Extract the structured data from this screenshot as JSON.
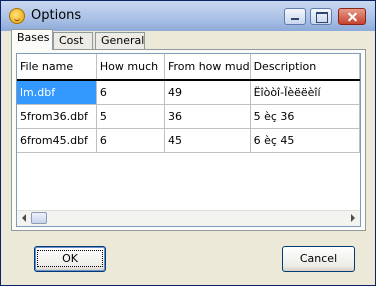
{
  "window": {
    "title": "Options"
  },
  "tabs": [
    {
      "label": "Bases",
      "active": true
    },
    {
      "label": "Cost",
      "active": false
    },
    {
      "label": "General",
      "active": false
    }
  ],
  "table": {
    "columns": [
      "File name",
      "How much",
      "From how mud",
      "Description"
    ],
    "rows": [
      [
        "lm.dbf",
        "6",
        "49",
        "Ëîòòî-Ïèëëèîí"
      ],
      [
        "5from36.dbf",
        "5",
        "36",
        "5 èç 36"
      ],
      [
        "6from45.dbf",
        "6",
        "45",
        "6 èç 45"
      ]
    ]
  },
  "buttons": {
    "ok": "OK",
    "cancel": "Cancel"
  },
  "colors": {
    "selection": "#3399ff",
    "titlebar": "#a9c0e6"
  }
}
